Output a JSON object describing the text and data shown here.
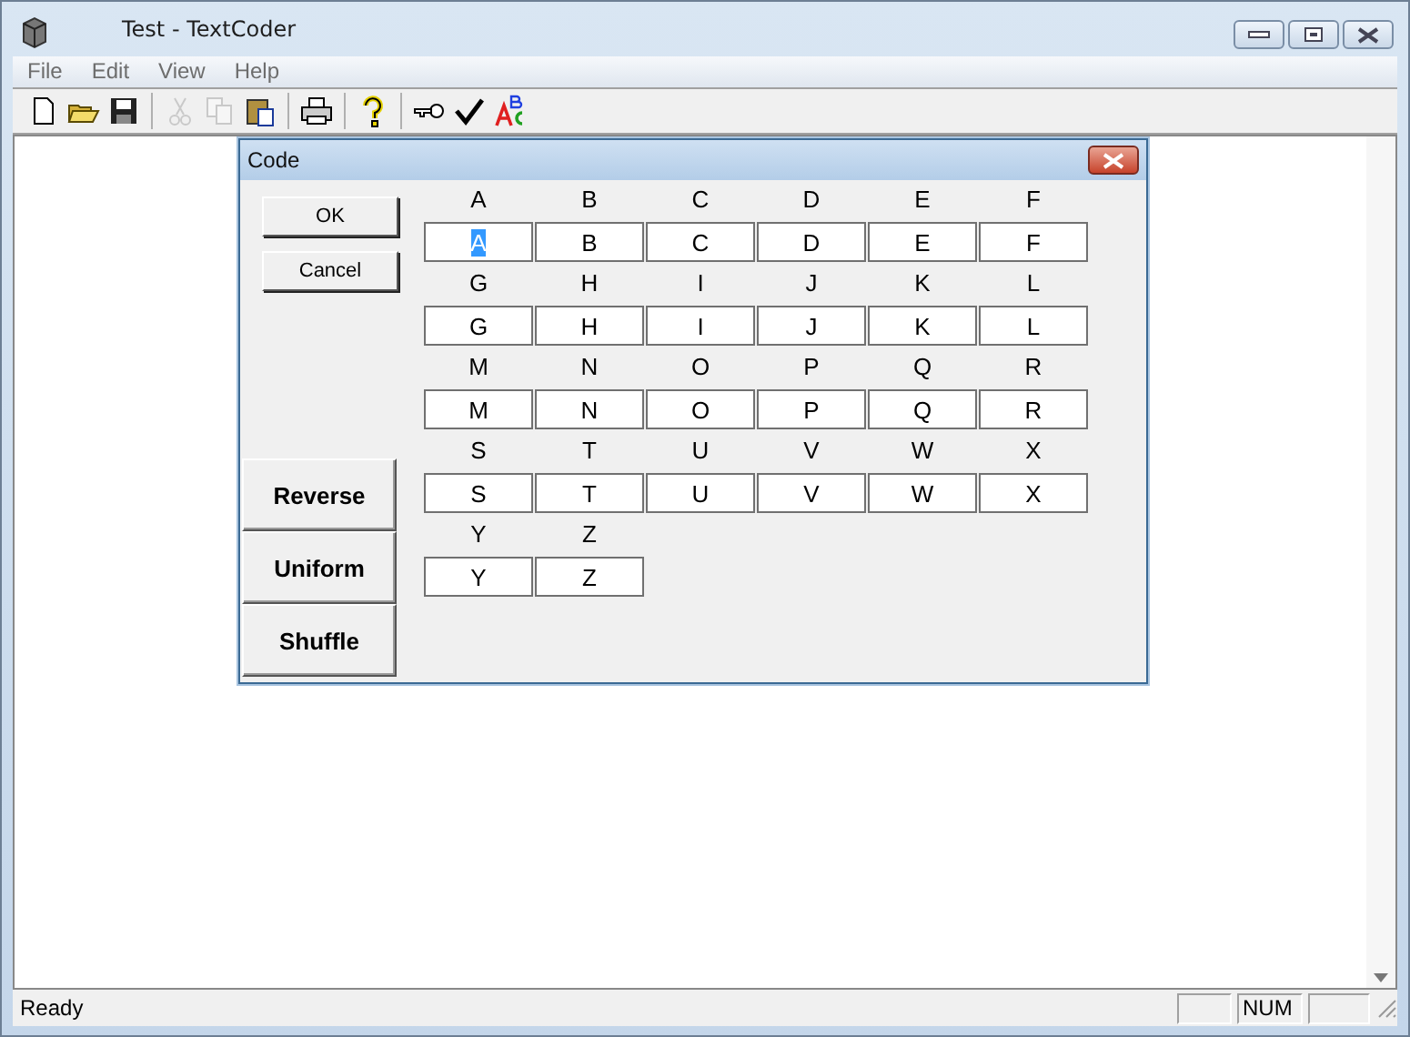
{
  "window": {
    "title": "Test - TextCoder"
  },
  "menu": [
    "File",
    "Edit",
    "View",
    "Help"
  ],
  "toolbar": [
    {
      "kind": "new",
      "disabled": false
    },
    {
      "kind": "open",
      "disabled": false
    },
    {
      "kind": "save",
      "disabled": false
    },
    {
      "kind": "sep"
    },
    {
      "kind": "cut",
      "disabled": true
    },
    {
      "kind": "copy",
      "disabled": true
    },
    {
      "kind": "paste",
      "disabled": false
    },
    {
      "kind": "sep"
    },
    {
      "kind": "print",
      "disabled": false
    },
    {
      "kind": "sep"
    },
    {
      "kind": "help",
      "disabled": false
    },
    {
      "kind": "sep"
    },
    {
      "kind": "key",
      "disabled": false
    },
    {
      "kind": "check",
      "disabled": false
    },
    {
      "kind": "spell",
      "disabled": false
    }
  ],
  "dialog": {
    "title": "Code",
    "ok": "OK",
    "cancel": "Cancel",
    "actions": [
      "Reverse",
      "Uniform",
      "Shuffle"
    ],
    "letters": [
      {
        "label": "A",
        "value": "A",
        "selected": true
      },
      {
        "label": "B",
        "value": "B",
        "selected": false
      },
      {
        "label": "C",
        "value": "C",
        "selected": false
      },
      {
        "label": "D",
        "value": "D",
        "selected": false
      },
      {
        "label": "E",
        "value": "E",
        "selected": false
      },
      {
        "label": "F",
        "value": "F",
        "selected": false
      },
      {
        "label": "G",
        "value": "G",
        "selected": false
      },
      {
        "label": "H",
        "value": "H",
        "selected": false
      },
      {
        "label": "I",
        "value": "I",
        "selected": false
      },
      {
        "label": "J",
        "value": "J",
        "selected": false
      },
      {
        "label": "K",
        "value": "K",
        "selected": false
      },
      {
        "label": "L",
        "value": "L",
        "selected": false
      },
      {
        "label": "M",
        "value": "M",
        "selected": false
      },
      {
        "label": "N",
        "value": "N",
        "selected": false
      },
      {
        "label": "O",
        "value": "O",
        "selected": false
      },
      {
        "label": "P",
        "value": "P",
        "selected": false
      },
      {
        "label": "Q",
        "value": "Q",
        "selected": false
      },
      {
        "label": "R",
        "value": "R",
        "selected": false
      },
      {
        "label": "S",
        "value": "S",
        "selected": false
      },
      {
        "label": "T",
        "value": "T",
        "selected": false
      },
      {
        "label": "U",
        "value": "U",
        "selected": false
      },
      {
        "label": "V",
        "value": "V",
        "selected": false
      },
      {
        "label": "W",
        "value": "W",
        "selected": false
      },
      {
        "label": "X",
        "value": "X",
        "selected": false
      },
      {
        "label": "Y",
        "value": "Y",
        "selected": false
      },
      {
        "label": "Z",
        "value": "Z",
        "selected": false
      }
    ]
  },
  "status_bar": {
    "message": "Ready",
    "indicator": "NUM"
  }
}
